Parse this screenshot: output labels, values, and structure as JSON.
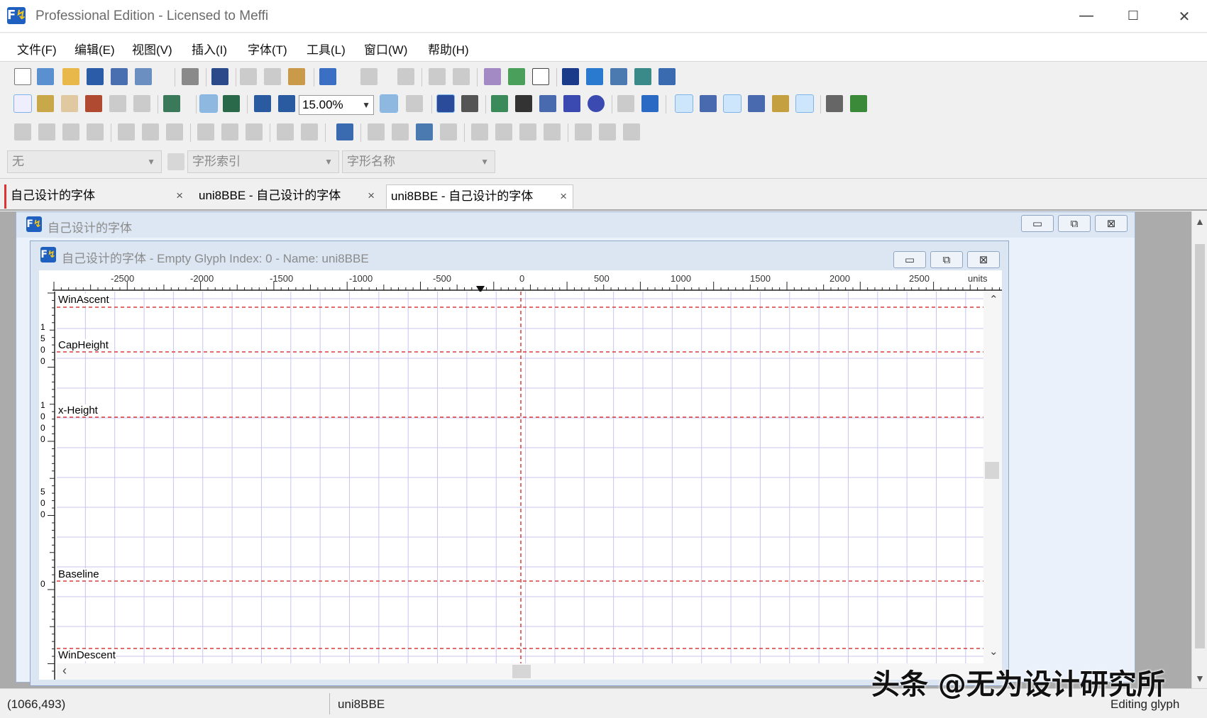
{
  "window": {
    "title": "Professional Edition - Licensed to Meffi",
    "minimize": "—",
    "maximize": "☐",
    "close": "✕"
  },
  "menu": [
    "文件(F)",
    "编辑(E)",
    "视图(V)",
    "插入(I)",
    "字体(T)",
    "工具(L)",
    "窗口(W)",
    "帮助(H)"
  ],
  "toolbar": {
    "zoom": "15.00%",
    "combo_style": "无",
    "combo_index_placeholder": "字形索引",
    "combo_name_placeholder": "字形名称"
  },
  "tabs": [
    {
      "label": "自己设计的字体",
      "close": "×"
    },
    {
      "label": "uni8BBE - 自己设计的字体",
      "close": "×"
    },
    {
      "label": "uni8BBE - 自己设计的字体",
      "close": "×"
    }
  ],
  "font_window": {
    "title": "自己设计的字体"
  },
  "glyph_window": {
    "title": "自己设计的字体 - Empty Glyph Index: 0 - Name: uni8BBE",
    "ruler_labels": [
      "-2500",
      "-2000",
      "-1500",
      "-1000",
      "-500",
      "0",
      "500",
      "1000",
      "1500",
      "2000",
      "2500",
      "units"
    ],
    "vertical_ruler_numbers": [
      [
        "1",
        "5",
        "0",
        "0"
      ],
      [
        "1",
        "0",
        "0",
        "0"
      ],
      [
        "5",
        "0",
        "0"
      ],
      [
        "0"
      ]
    ],
    "metrics": [
      "WinAscent",
      "CapHeight",
      "x-Height",
      "Baseline",
      "WinDescent"
    ]
  },
  "mdi_buttons": {
    "minimize": "▭",
    "restore": "⧉",
    "close": "⊠"
  },
  "scroll_glyphs": {
    "up": "⌃",
    "down": "⌄",
    "left": "‹"
  },
  "status": {
    "coords": "(1066,493)",
    "glyph_name": "uni8BBE",
    "mode": "Editing glyph"
  },
  "watermark": "头条 @无为设计研究所",
  "colors": {
    "grid": "#c8c4ef",
    "metric_line": "#d83a3a",
    "origin_line": "#d83a3a"
  }
}
